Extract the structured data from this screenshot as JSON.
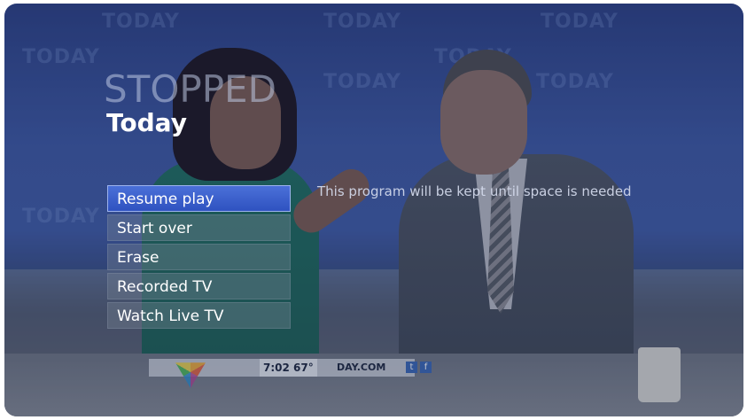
{
  "player": {
    "state": "STOPPED",
    "program_title": "Today",
    "info_message": "This program will be kept until space is needed"
  },
  "menu": {
    "selected_index": 0,
    "items": [
      {
        "label": "Resume play"
      },
      {
        "label": "Start over"
      },
      {
        "label": "Erase"
      },
      {
        "label": "Recorded TV"
      },
      {
        "label": "Watch Live TV"
      }
    ]
  },
  "ticker": {
    "time": "7:02",
    "temperature": "67°",
    "site": "DAY.COM"
  },
  "background": {
    "watermark": "TODAY"
  },
  "colors": {
    "selected_item": "#3a5fcc",
    "title_text": "#ffffff",
    "state_text": "#bec8e1"
  }
}
